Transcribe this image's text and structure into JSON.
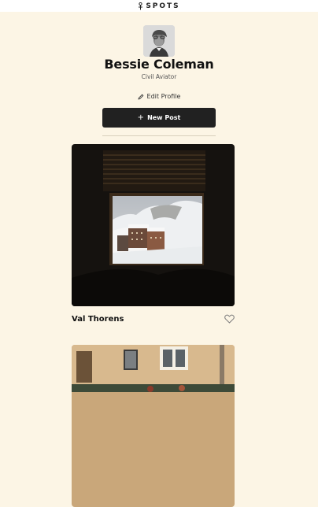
{
  "header": {
    "logo_text": "SPOTS",
    "logo_icon": "spot-pin-icon"
  },
  "profile": {
    "name": "Bessie Coleman",
    "role": "Civil Aviator",
    "edit_label": "Edit Profile",
    "edit_icon": "pencil-icon",
    "new_post_label": "New Post",
    "new_post_icon": "plus-icon"
  },
  "cards": [
    {
      "title": "Val Thorens",
      "like_icon": "heart-icon",
      "liked": false
    },
    {
      "title": "",
      "like_icon": "heart-icon",
      "liked": false
    }
  ],
  "colors": {
    "background": "#fcf5e5",
    "button": "#212121",
    "text": "#212121"
  }
}
